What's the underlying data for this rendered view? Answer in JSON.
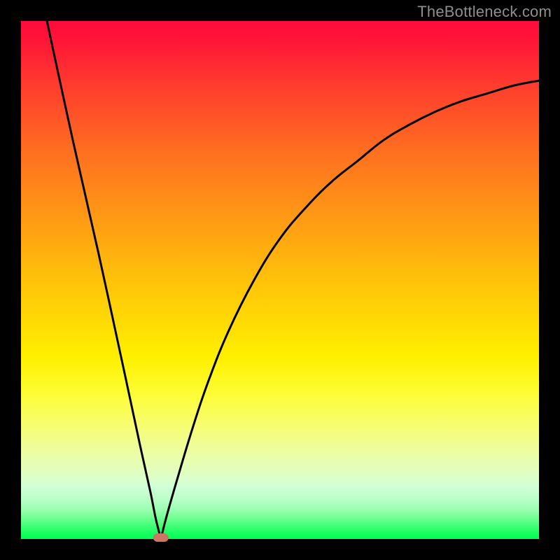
{
  "watermark": "TheBottleneck.com",
  "chart_data": {
    "type": "line",
    "title": "",
    "xlabel": "",
    "ylabel": "",
    "xlim": [
      0,
      100
    ],
    "ylim": [
      0,
      100
    ],
    "background_gradient": {
      "top_color": "#ff0a3c",
      "bottom_color": "#00ff55",
      "meaning": "red = high bottleneck, green = low bottleneck"
    },
    "minimum_point": {
      "x": 27,
      "y": 0
    },
    "marker": {
      "shape": "pill",
      "approx_color": "#cc7763",
      "x": 27,
      "y": 0
    },
    "series": [
      {
        "name": "bottleneck-curve",
        "x": [
          5,
          10,
          15,
          20,
          23,
          25,
          26,
          27,
          28,
          30,
          33,
          36,
          40,
          45,
          50,
          55,
          60,
          65,
          70,
          75,
          80,
          85,
          90,
          95,
          100
        ],
        "y": [
          100,
          77,
          55,
          32,
          18,
          9,
          4,
          0,
          4,
          11,
          21,
          30,
          40,
          50,
          58,
          64,
          69,
          73,
          77,
          80,
          82.5,
          84.5,
          86,
          87.5,
          88.5
        ]
      }
    ]
  }
}
